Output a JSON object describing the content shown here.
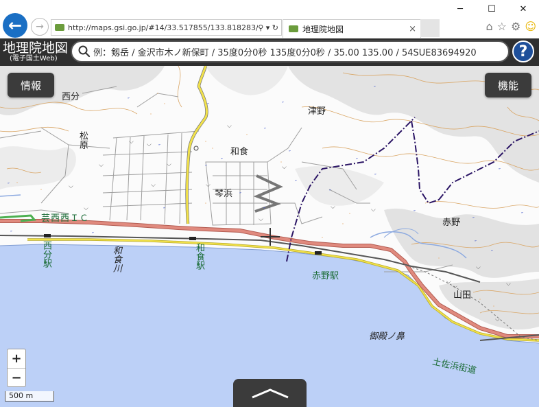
{
  "browser": {
    "url": "http://maps.gsi.go.jp/#14/33.517855/133.818283/",
    "url_controls": "⚲ ▾ ↻",
    "tab_title": "地理院地図",
    "tab_close": "×"
  },
  "app": {
    "title": "地理院地図",
    "subtitle": "(電子国土Web)",
    "search_placeholder": "例：剱岳 / 金沢市木ノ新保町 / 35度0分0秒 135度0分0秒 / 35.00 135.00 / 54SUE83694920",
    "help_label": "?"
  },
  "controls": {
    "info_label": "情報",
    "func_label": "機能",
    "zoom_in": "+",
    "zoom_out": "−",
    "scale": "500 m"
  },
  "map_labels": {
    "nishibun": "西分",
    "matsubara": "松原",
    "tsuno": "津野",
    "wajiki": "和食",
    "kotogahama": "琴浜",
    "aki_nishi_ic": "芸西西ＩＣ",
    "nishibun_station": "西分駅",
    "wajiki_river": "和食川",
    "wajiki_station": "和食駅",
    "akano_station": "赤野駅",
    "akano": "赤野",
    "yamada": "山田",
    "gotenosaki": "御殿ノ鼻",
    "tosahama_road": "土佐浜街道"
  },
  "colors": {
    "sea": "#bcd0f7",
    "road_major": "#e08a7e",
    "road_yellow": "#f2e24a",
    "rail": "#555555",
    "boundary": "#2b1565",
    "contour": "#d9a564",
    "appbar": "#2f2f2f",
    "accent_blue": "#1a6fc4"
  }
}
